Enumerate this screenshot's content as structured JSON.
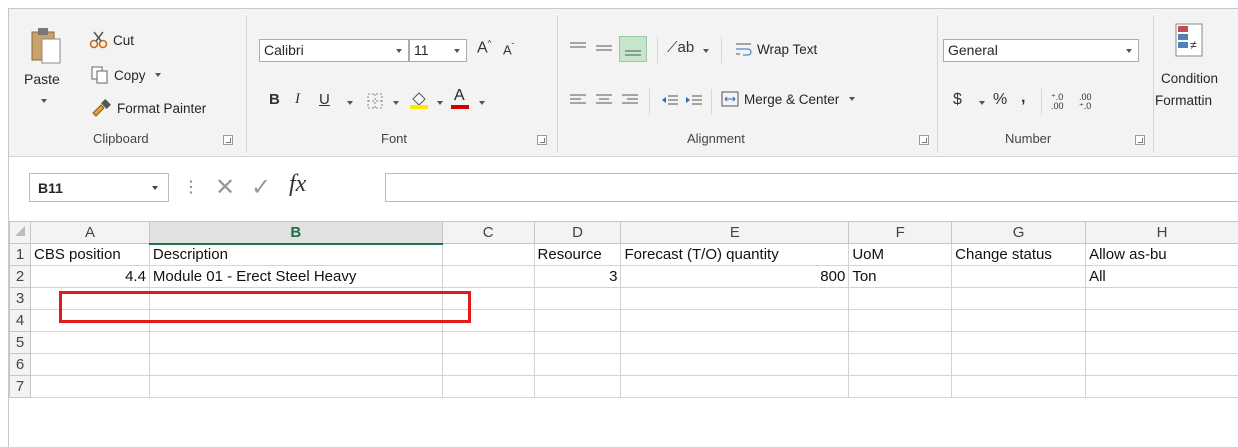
{
  "ribbon": {
    "clipboard": {
      "paste_label": "Paste",
      "cut_label": "Cut",
      "copy_label": "Copy",
      "format_painter_label": "Format Painter",
      "group_label": "Clipboard"
    },
    "font": {
      "font_name": "Calibri",
      "font_size": "11",
      "grow_label": "A",
      "shrink_label": "A",
      "bold_label": "B",
      "italic_label": "I",
      "underline_label": "U",
      "font_color_label": "A",
      "group_label": "Font"
    },
    "alignment": {
      "wrap_text_label": "Wrap Text",
      "merge_center_label": "Merge & Center",
      "group_label": "Alignment"
    },
    "number": {
      "format": "General",
      "currency_label": "$",
      "percent_label": "%",
      "comma_label": ",",
      "inc_decimal_label": "⁺.0 .00",
      "dec_decimal_label": ".00 ⁺.0",
      "group_label": "Number"
    },
    "styles": {
      "conditional_formatting_label_1": "Condition",
      "conditional_formatting_label_2": "Formattin"
    }
  },
  "formula_bar": {
    "name_box": "B11",
    "cancel_label": "✕",
    "enter_label": "✓",
    "fx_label": "fx",
    "formula": ""
  },
  "grid": {
    "columns": [
      "A",
      "B",
      "C",
      "D",
      "E",
      "F",
      "G",
      "H"
    ],
    "selected_column": "B",
    "rows": [
      {
        "num": "1",
        "cells": [
          "CBS position",
          "Description",
          "",
          "Resource",
          "Forecast (T/O) quantity",
          "UoM",
          "Change status",
          "Allow as-bu"
        ]
      },
      {
        "num": "2",
        "cells": [
          "4.4",
          "Module 01 - Erect Steel Heavy",
          "",
          "3",
          "800",
          "Ton",
          "",
          "All"
        ]
      },
      {
        "num": "3",
        "cells": [
          "",
          "",
          "",
          "",
          "",
          "",
          "",
          ""
        ]
      },
      {
        "num": "4",
        "cells": [
          "",
          "",
          "",
          "",
          "",
          "",
          "",
          ""
        ]
      },
      {
        "num": "5",
        "cells": [
          "",
          "",
          "",
          "",
          "",
          "",
          "",
          ""
        ]
      },
      {
        "num": "6",
        "cells": [
          "",
          "",
          "",
          "",
          "",
          "",
          "",
          ""
        ]
      },
      {
        "num": "7",
        "cells": [
          "",
          "",
          "",
          "",
          "",
          "",
          "",
          ""
        ]
      }
    ]
  },
  "colors": {
    "accent_green": "#217346",
    "highlight_red": "#e01b1b",
    "fill_yellow": "#ffe500",
    "font_red": "#d00000"
  }
}
